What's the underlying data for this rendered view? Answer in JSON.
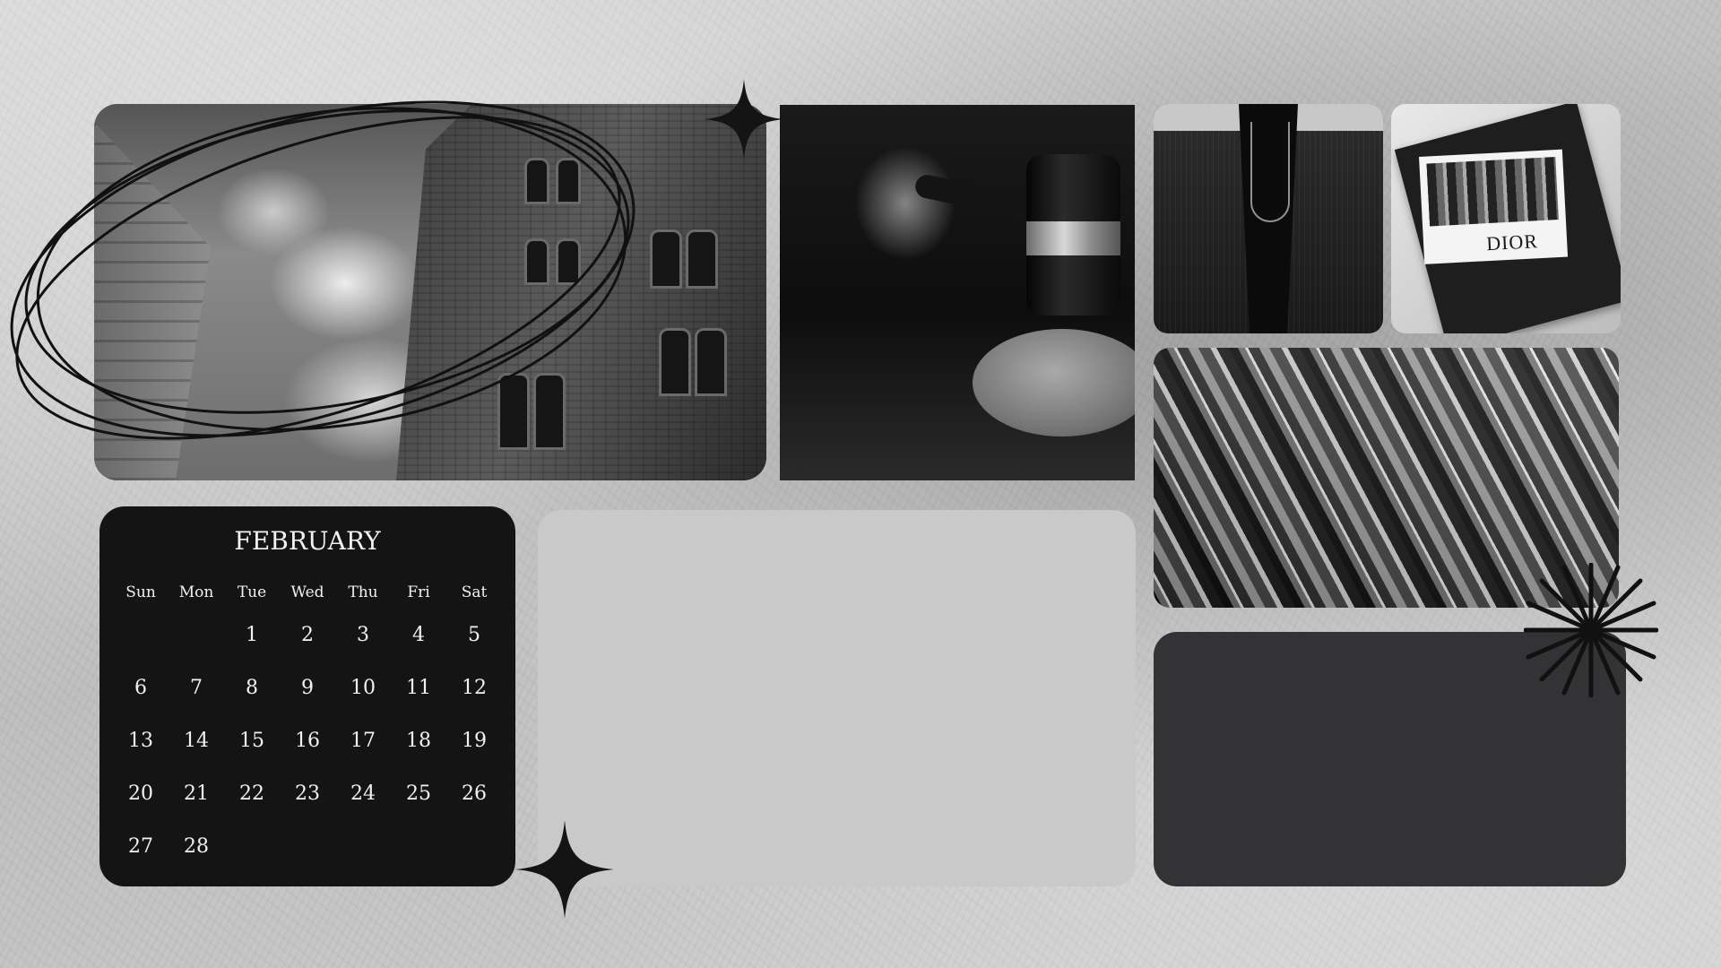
{
  "calendar": {
    "month": "FEBRUARY",
    "weekdays": [
      "Sun",
      "Mon",
      "Tue",
      "Wed",
      "Thu",
      "Fri",
      "Sat"
    ],
    "leading_blanks": 2,
    "days": [
      "1",
      "2",
      "3",
      "4",
      "5",
      "6",
      "7",
      "8",
      "9",
      "10",
      "11",
      "12",
      "13",
      "14",
      "15",
      "16",
      "17",
      "18",
      "19",
      "20",
      "21",
      "22",
      "23",
      "24",
      "25",
      "26",
      "27",
      "28"
    ]
  },
  "magazine": {
    "brand": "DIOR"
  },
  "images": {
    "building": "building-photo",
    "gavel": "gavel-photo",
    "blazer": "blazer-photo",
    "magazine": "magazine-photo",
    "marble": "marble-photo"
  },
  "colors": {
    "background": "#c8c8c8",
    "calendar_bg": "#141414",
    "light_panel": "#c9c9c9",
    "dark_panel": "#333234",
    "text_light": "#f2f2f2"
  }
}
